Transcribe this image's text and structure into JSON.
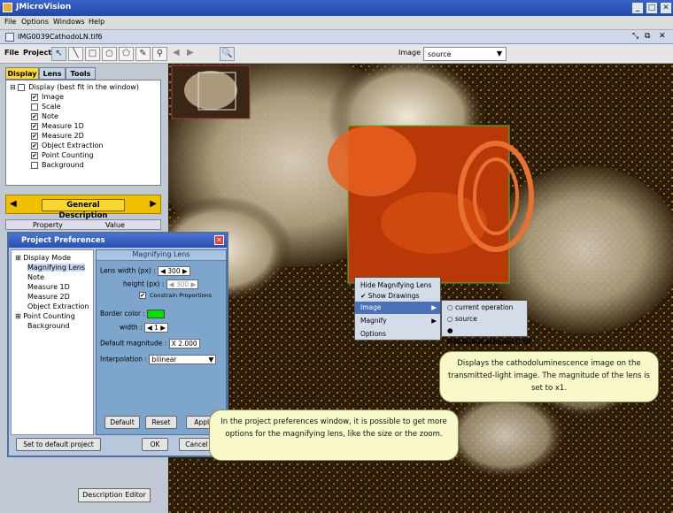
{
  "app": {
    "title": "JMicroVision"
  },
  "menubar": {
    "items": [
      "File",
      "Options",
      "Windows",
      "Help"
    ]
  },
  "document": {
    "tab_title": "IMG0039CathodoLN.tif6"
  },
  "toolbar": {
    "file_label": "File",
    "project_label": "Project",
    "image_label": "Image :",
    "image_value": "source"
  },
  "left_panel": {
    "tabs": [
      "Display",
      "Lens",
      "Tools"
    ],
    "tree": {
      "root": "Display (best fit in the window)",
      "items": [
        {
          "label": "Image",
          "checked": true
        },
        {
          "label": "Scale",
          "checked": false
        },
        {
          "label": "Note",
          "checked": true
        },
        {
          "label": "Measure 1D",
          "checked": true
        },
        {
          "label": "Measure 2D",
          "checked": true
        },
        {
          "label": "Object Extraction",
          "checked": true
        },
        {
          "label": "Point Counting",
          "checked": true
        },
        {
          "label": "Background",
          "checked": false
        }
      ]
    },
    "description_title": "General Description",
    "property_headers": [
      "Property",
      "Value"
    ],
    "description_editor": "Description Editor"
  },
  "prefs": {
    "title": "Project Preferences",
    "tree_items": [
      "Display Mode",
      "Magnifying Lens",
      "Note",
      "Measure 1D",
      "Measure 2D",
      "Object Extraction",
      "Point Counting",
      "Background"
    ],
    "panel_title": "Magnifying Lens",
    "lens_width_label": "Lens width (px) :",
    "lens_width_value": "300",
    "height_label": "height (px) :",
    "height_value": "300",
    "constrain_label": "Constrain Proportions",
    "border_color_label": "Border color :",
    "border_color": "#00e000",
    "width_label": "width :",
    "width_value": "1",
    "default_magnitude_label": "Default magnitude :",
    "default_magnitude_value": "X 2.000",
    "interpolation_label": "Interpolation :",
    "interpolation_value": "bilinear",
    "buttons": {
      "default": "Default",
      "reset": "Reset",
      "apply": "Apply",
      "set_default": "Set to default project",
      "ok": "OK",
      "cancel": "Cancel"
    }
  },
  "context_menu": {
    "hide_lens": "Hide Magnifying Lens",
    "show_drawings": "Show Drawings",
    "image": "Image",
    "magnify": "Magnify",
    "options": "Options"
  },
  "submenu": {
    "items": [
      "current operation",
      "source",
      "IMG0040CathodoLC.tif"
    ],
    "selected_index": 2
  },
  "callouts": {
    "right": "Displays the cathodoluminescence image on the transmitted-light image. The magnitude of the lens is set to x1.",
    "bottom": "In the project preferences window, it is possible to get more options for the magnifying lens, like the size or the zoom."
  }
}
